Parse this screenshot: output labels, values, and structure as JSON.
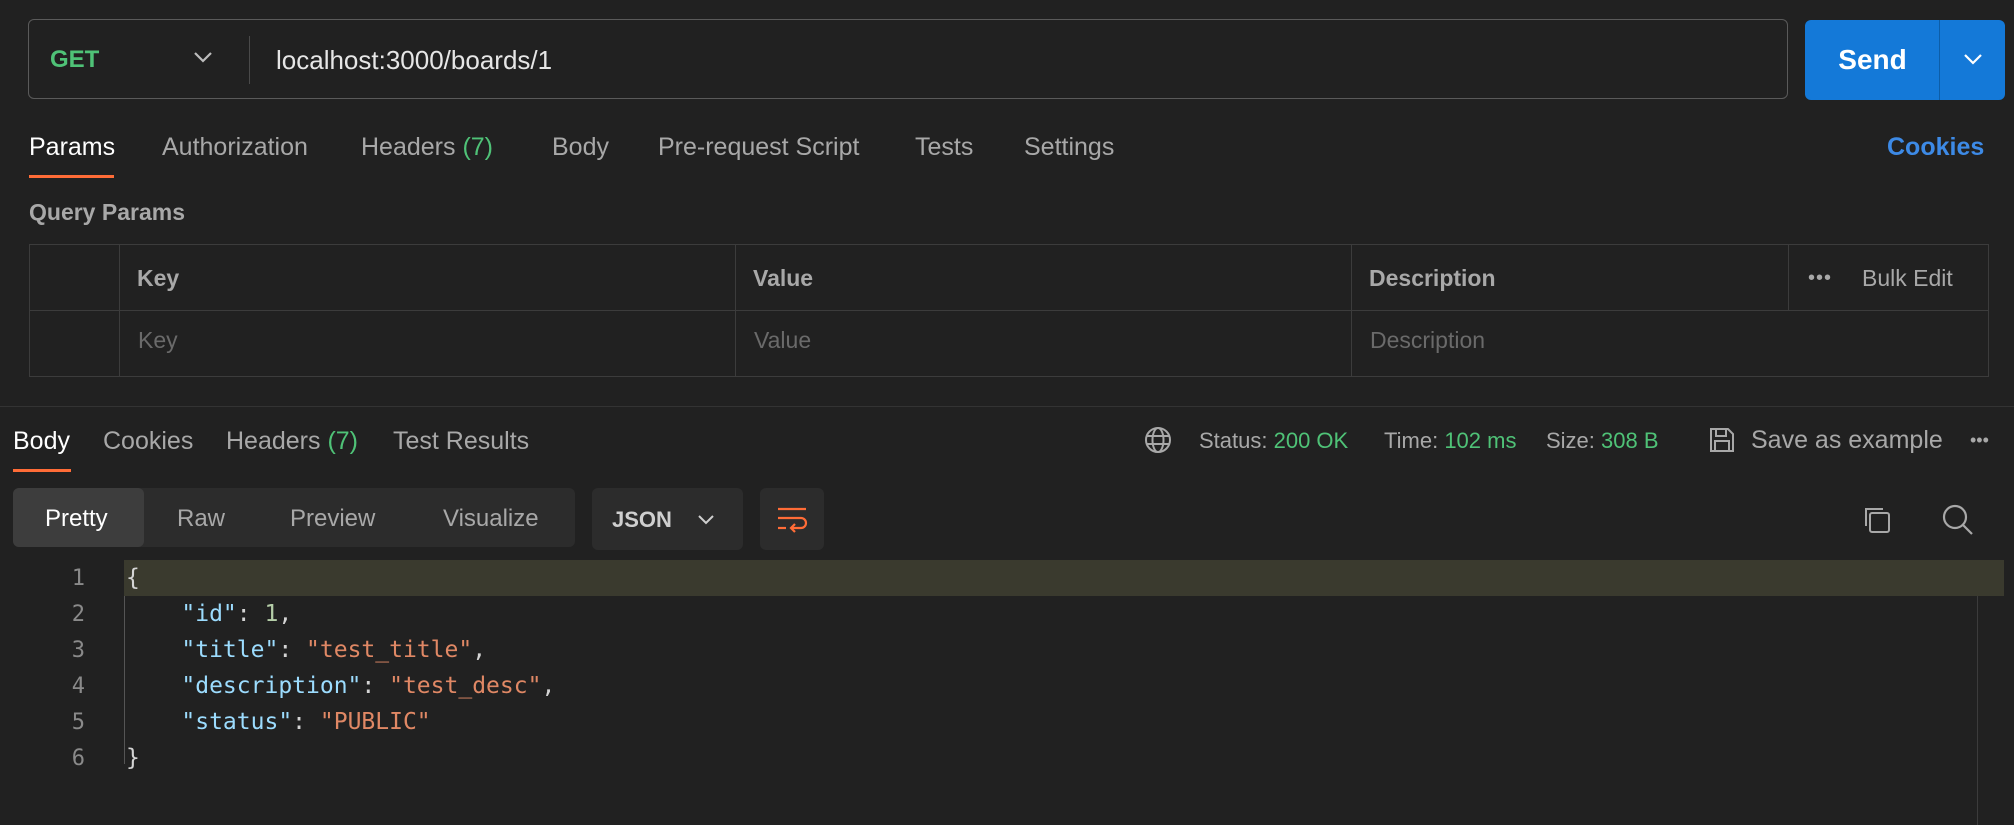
{
  "request": {
    "method": "GET",
    "url": "localhost:3000/boards/1",
    "send_label": "Send"
  },
  "request_tabs": [
    {
      "label": "Params",
      "active": true
    },
    {
      "label": "Authorization"
    },
    {
      "label": "Headers",
      "badge": "(7)"
    },
    {
      "label": "Body"
    },
    {
      "label": "Pre-request Script"
    },
    {
      "label": "Tests"
    },
    {
      "label": "Settings"
    }
  ],
  "cookies_link": "Cookies",
  "query_params": {
    "title": "Query Params",
    "columns": [
      "Key",
      "Value",
      "Description"
    ],
    "bulk_edit": "Bulk Edit",
    "placeholders": {
      "key": "Key",
      "value": "Value",
      "description": "Description"
    }
  },
  "response_tabs": [
    {
      "label": "Body",
      "active": true
    },
    {
      "label": "Cookies"
    },
    {
      "label": "Headers",
      "badge": "(7)"
    },
    {
      "label": "Test Results"
    }
  ],
  "response_meta": {
    "status_label": "Status:",
    "status_value": "200 OK",
    "time_label": "Time:",
    "time_value": "102 ms",
    "size_label": "Size:",
    "size_value": "308 B",
    "save_example": "Save as example"
  },
  "view_modes": [
    "Pretty",
    "Raw",
    "Preview",
    "Visualize"
  ],
  "format": "JSON",
  "code_lines": {
    "line_numbers": [
      "1",
      "2",
      "3",
      "4",
      "5",
      "6"
    ],
    "open": "{",
    "close": "}",
    "entries": [
      {
        "key": "\"id\"",
        "value": "1",
        "type": "number",
        "comma": ","
      },
      {
        "key": "\"title\"",
        "value": "\"test_title\"",
        "type": "string",
        "comma": ","
      },
      {
        "key": "\"description\"",
        "value": "\"test_desc\"",
        "type": "string",
        "comma": ","
      },
      {
        "key": "\"status\"",
        "value": "\"PUBLIC\"",
        "type": "string",
        "comma": ""
      }
    ]
  },
  "colors": {
    "accent_orange": "#ff6c37",
    "send_blue": "#1479d8",
    "success_green": "#4fc277",
    "link_blue": "#3d8ae6"
  }
}
